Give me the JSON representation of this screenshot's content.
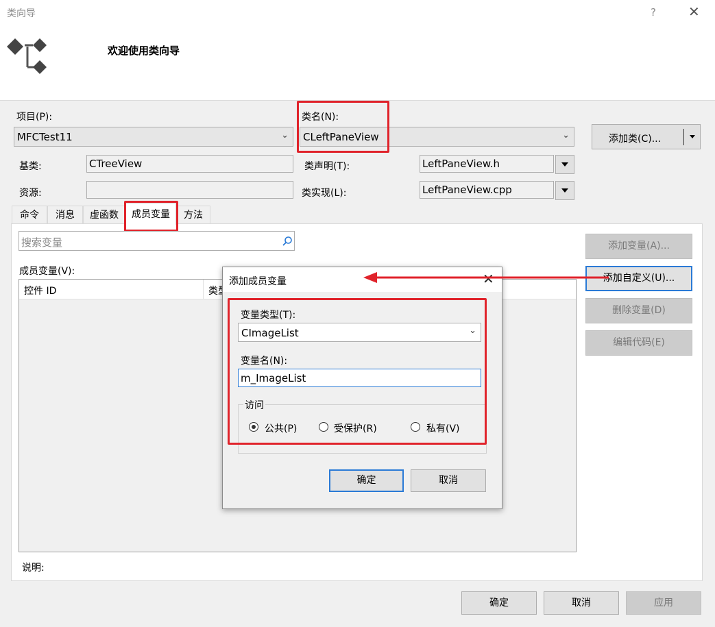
{
  "window": {
    "title": "类向导",
    "help": "?",
    "close": "✕"
  },
  "banner": {
    "welcome": "欢迎使用类向导"
  },
  "project": {
    "label": "项目(P):",
    "value": "MFCTest11"
  },
  "classname": {
    "label": "类名(N):",
    "value": "CLeftPaneView"
  },
  "add_class_button": "添加类(C)...",
  "base_class": {
    "label": "基类:",
    "value": "CTreeView"
  },
  "resource": {
    "label": "资源:",
    "value": ""
  },
  "class_decl": {
    "label": "类声明(T):",
    "value": "LeftPaneView.h"
  },
  "class_impl": {
    "label": "类实现(L):",
    "value": "LeftPaneView.cpp"
  },
  "tabs": [
    "命令",
    "消息",
    "虚函数",
    "成员变量",
    "方法"
  ],
  "active_tab": "成员变量",
  "search": {
    "placeholder": "搜索变量"
  },
  "members": {
    "label": "成员变量(V):",
    "columns": [
      "控件 ID",
      "类型"
    ]
  },
  "side_buttons": {
    "add_var": "添加变量(A)...",
    "add_custom": "添加自定义(U)...",
    "delete_var": "删除变量(D)",
    "edit_code": "编辑代码(E)"
  },
  "description_label": "说明:",
  "footer": {
    "ok": "确定",
    "cancel": "取消",
    "apply": "应用"
  },
  "dialog": {
    "title": "添加成员变量",
    "type_label": "变量类型(T):",
    "type_value": "CImageList",
    "name_label": "变量名(N):",
    "name_value": "m_ImageList",
    "access_label": "访问",
    "access_options": [
      "公共(P)",
      "受保护(R)",
      "私有(V)"
    ],
    "access_selected": "公共(P)",
    "ok": "确定",
    "cancel": "取消"
  },
  "colors": {
    "annotation_red": "#e0232b",
    "focus_blue": "#2a7ad6"
  },
  "icons": [
    "wizard-logo-icon",
    "search-icon",
    "close-icon",
    "chevron-down-icon",
    "split-arrow-icon"
  ]
}
